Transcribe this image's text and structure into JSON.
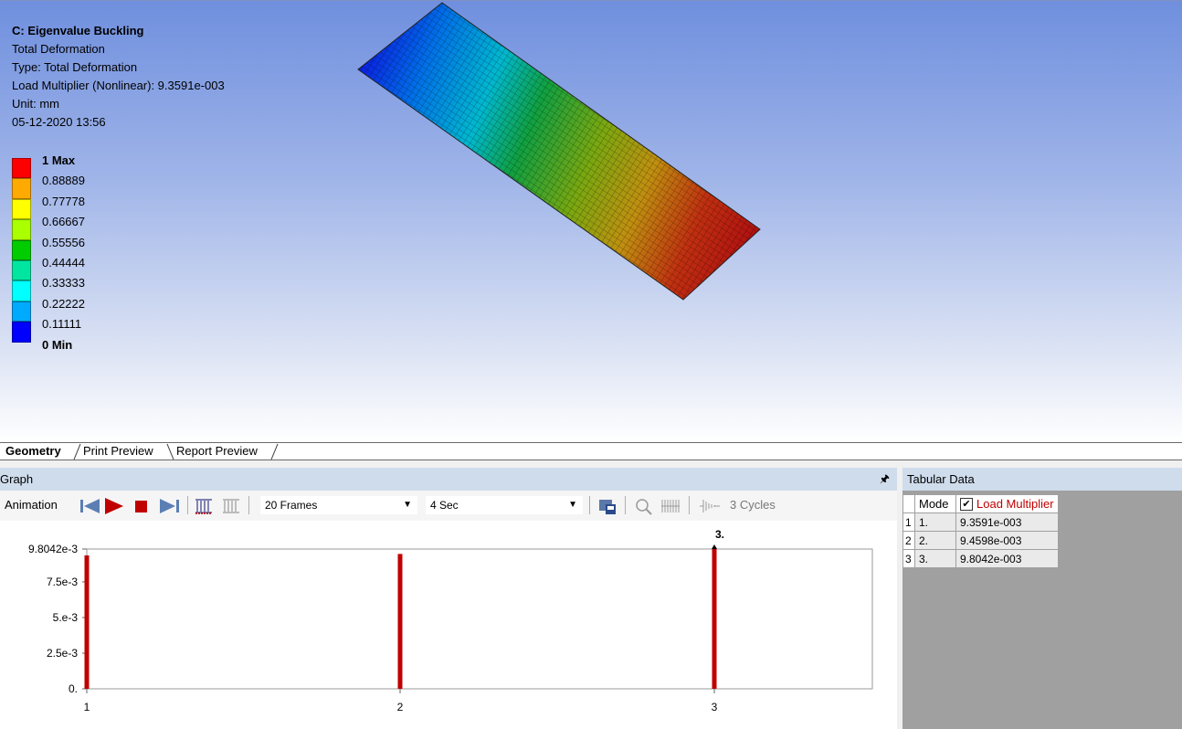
{
  "viewport": {
    "info": {
      "title": "C: Eigenvalue Buckling",
      "result": "Total Deformation",
      "type": "Type: Total Deformation",
      "load_multiplier": "Load Multiplier (Nonlinear): 9.3591e-003",
      "unit": "Unit: mm",
      "timestamp": "05-12-2020 13:56"
    },
    "legend": {
      "labels": [
        "1 Max",
        "0.88889",
        "0.77778",
        "0.66667",
        "0.55556",
        "0.44444",
        "0.33333",
        "0.22222",
        "0.11111",
        "0 Min"
      ],
      "colors": [
        "#ff0000",
        "#ffaa00",
        "#ffff00",
        "#aaff00",
        "#00cc00",
        "#00e6a0",
        "#00ffff",
        "#00aaff",
        "#0000ff"
      ]
    }
  },
  "tabs": [
    "Geometry",
    "Print Preview",
    "Report Preview"
  ],
  "graph": {
    "title": "Graph",
    "toolbar": {
      "animation_label": "Animation",
      "frames": "20 Frames",
      "duration": "4 Sec",
      "cycles": "3 Cycles"
    }
  },
  "chart_data": {
    "type": "bar",
    "categories": [
      "1",
      "2",
      "3"
    ],
    "values": [
      0.0093591,
      0.0094598,
      0.0098042
    ],
    "ytick_labels": [
      "9.8042e-3",
      "7.5e-3",
      "5.e-3",
      "2.5e-3",
      "0."
    ],
    "yticks": [
      0.0098042,
      0.0075,
      0.005,
      0.0025,
      0
    ],
    "ylim": [
      0,
      0.0098042
    ],
    "selected_label": "3.",
    "bar_color": "#c00000"
  },
  "tabular": {
    "title": "Tabular Data",
    "columns": [
      "Mode",
      "Load Multiplier"
    ],
    "rows": [
      {
        "index": "1",
        "mode": "1.",
        "value": "9.3591e-003"
      },
      {
        "index": "2",
        "mode": "2.",
        "value": "9.4598e-003"
      },
      {
        "index": "3",
        "mode": "3.",
        "value": "9.8042e-003"
      }
    ]
  }
}
